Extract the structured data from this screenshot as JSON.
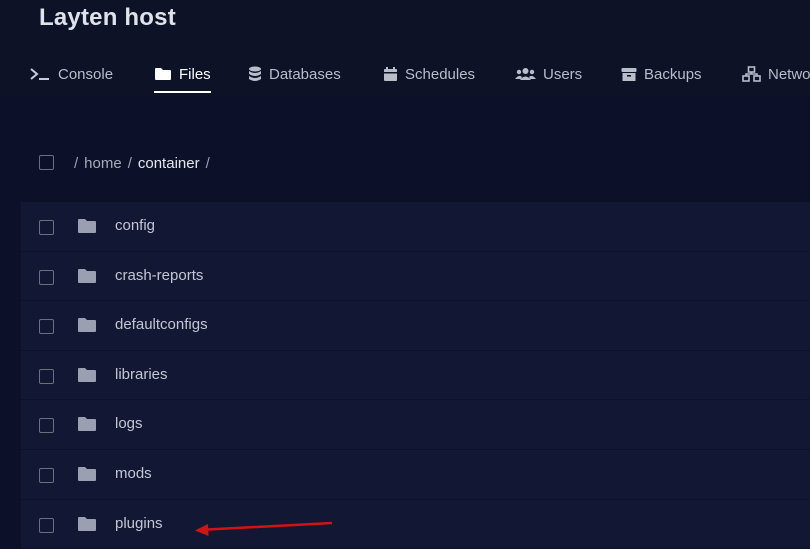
{
  "server": {
    "title": "Layten host"
  },
  "tabs": [
    {
      "label": "Console",
      "icon": "terminal-icon"
    },
    {
      "label": "Files",
      "icon": "folder-icon",
      "active": true
    },
    {
      "label": "Databases",
      "icon": "database-icon"
    },
    {
      "label": "Schedules",
      "icon": "calendar-icon"
    },
    {
      "label": "Users",
      "icon": "users-icon"
    },
    {
      "label": "Backups",
      "icon": "archive-icon"
    },
    {
      "label": "Netwo",
      "icon": "network-icon"
    }
  ],
  "breadcrumb": {
    "sep1": "/",
    "home": "home",
    "sep2": "/",
    "container": "container",
    "sep3": "/"
  },
  "files": [
    {
      "name": "config"
    },
    {
      "name": "crash-reports"
    },
    {
      "name": "defaultconfigs"
    },
    {
      "name": "libraries"
    },
    {
      "name": "logs"
    },
    {
      "name": "mods"
    },
    {
      "name": "plugins"
    }
  ],
  "colors": {
    "background": "#0c1129",
    "row": "#121833",
    "annotation_arrow": "#d01414"
  }
}
